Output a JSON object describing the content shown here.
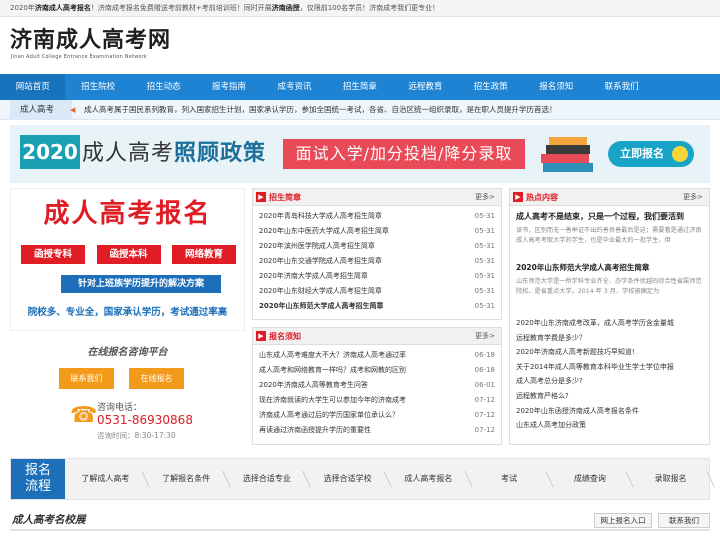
{
  "topbar": {
    "text_prefix": "2020年",
    "text_bold": "济南成人高考报名",
    "text_mid": "！济南成考报名免费赠送考前教材+考前培训班！同时开展",
    "text_bold2": "济南函授",
    "text_end": "，仅限前100名学员！济南成考我们更专业！"
  },
  "header": {
    "title": "济南成人高考网",
    "subtitle": "Jinan Adult College Entrance Examination Network"
  },
  "nav": [
    "网站首页",
    "招生院校",
    "招生动态",
    "报考指南",
    "成考资讯",
    "招生简章",
    "远程教育",
    "招生政策",
    "报名须知",
    "联系我们"
  ],
  "ticker": {
    "tag": "成人高考",
    "text": "成人高考属于国民系列教育，列入国家招生计划，国家承认学历，参加全国统一考试，各省、自治区统一组织录取，是在职人员提升学历首选！"
  },
  "banner": {
    "year": "2020",
    "main_prefix": "成人高考",
    "main_bold": "照顾政策",
    "box": "面试入学/加分投档/降分录取",
    "button": "立即报名"
  },
  "promo": {
    "title": "成人高考报名",
    "tags": [
      "函授专科",
      "函授本科",
      "网络教育"
    ],
    "strip": "针对上班族学历提升的解决方案",
    "foot": "院校多、专业全，国家承认学历，考试通过率高"
  },
  "consult": {
    "title": "在线报名咨询平台",
    "contact_btn": "联系我们",
    "online_btn": "在线报名",
    "phone_label": "咨询电话：",
    "phone": "0531-86930868",
    "hours": "咨询时间：8:30-17:30"
  },
  "brochure": {
    "title": "招生简章",
    "more": "更多>",
    "items": [
      {
        "t": "2020年青岛科技大学成人高考招生简章",
        "d": "05-31"
      },
      {
        "t": "2020年山东中医药大学成人高考招生简章",
        "d": "05-31"
      },
      {
        "t": "2020年滨州医学院成人高考招生简章",
        "d": "05-31"
      },
      {
        "t": "2020年山东交通学院成人高考招生简章",
        "d": "05-31"
      },
      {
        "t": "2020年济南大学成人高考招生简章",
        "d": "05-31"
      },
      {
        "t": "2020年山东财经大学成人高考招生简章",
        "d": "05-31"
      },
      {
        "t": "2020年山东师范大学成人高考招生简章",
        "d": "05-31"
      }
    ]
  },
  "notice": {
    "title": "报名须知",
    "more": "更多>",
    "items": [
      {
        "t": "山东成人高考难度大不大？济南成人高考通过率",
        "d": "06-18"
      },
      {
        "t": "成人高考和网络教育一样吗？成考和网教的区别",
        "d": "06-18"
      },
      {
        "t": "2020年济南成人高等教育考生问答",
        "d": "06-01"
      },
      {
        "t": "现在济南就读的大学生可以参加今年的济南成考",
        "d": "07-12"
      },
      {
        "t": "济南成人高考通过后的学历国家单位承认么？",
        "d": "07-12"
      },
      {
        "t": "再读通过济南函授提升学历的重要性",
        "d": "07-12"
      }
    ]
  },
  "hot": {
    "title": "热点内容",
    "more": "更多>",
    "feature1_title": "成人高考不是结束，只是一个过程，我们要活到",
    "feature1_desc": "读书，区别而无一善举证不出的善良善最后是这；需要看是通过济南成人高考考取大学的学生，也是毕业最大的一批学生，但",
    "feature2_title": "2020年山东师范大学成人高考招生简章",
    "feature2_desc": "山东师范大学是一所学科专业齐全、办学条件优越的综合性省属师范院校。是省重点大学。2014 年 3 月，学校被确定为",
    "items": [
      "2020年山东济南成考改革，成人高考学历含金量城",
      "远程教育学费是多少？",
      "2020年济南成人高考新题技巧早知道!",
      "关于2014年成人高等教育本科毕业生学士学位申报",
      "成人高考总分是多少?",
      "远程教育严格么?",
      "2020年山东函授济南成人高考报名条件",
      "山东成人高考加分政策"
    ]
  },
  "process": {
    "head": "报名流程",
    "steps": [
      "了解成人高考",
      "了解报名条件",
      "选择合适专业",
      "选择合适学校",
      "成人高考报名",
      "考试",
      "成绩查询",
      "录取报名"
    ]
  },
  "famous": {
    "title": "成人高考名校展",
    "btn1": "网上报名入口",
    "btn2": "联系我们"
  },
  "colors": {
    "nav": "#1e83d3",
    "accent_red": "#e01c24",
    "accent_orange": "#f39a1b",
    "brand_blue": "#1c6fb8"
  }
}
